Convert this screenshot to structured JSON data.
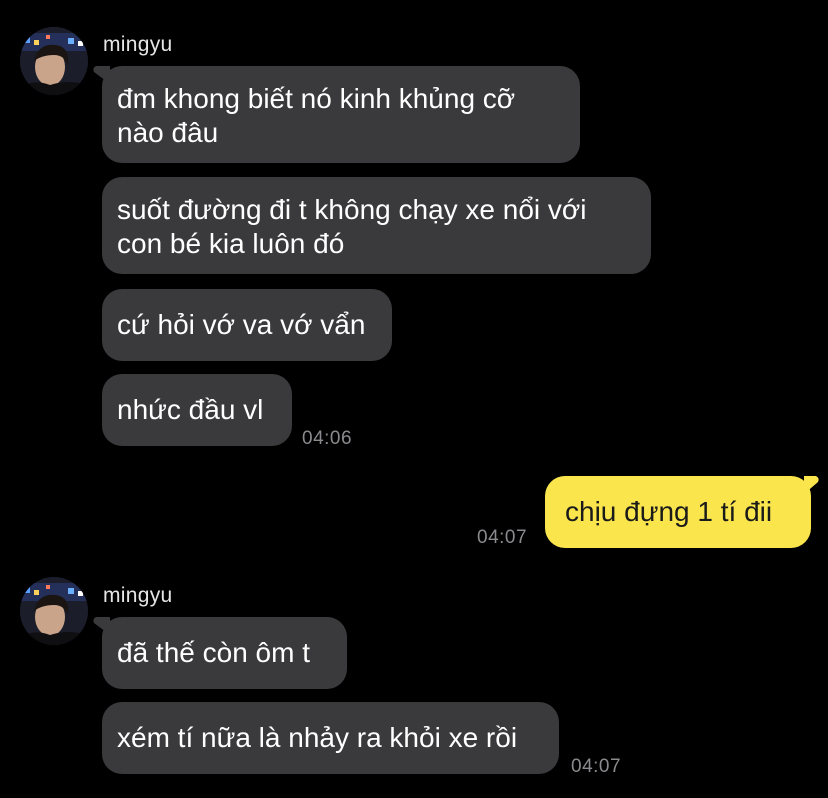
{
  "chat": {
    "groups": [
      {
        "sender": "mingyu",
        "messages": [
          "đm khong biết nó kinh khủng cỡ\nnào đâu",
          "suốt đường đi t không chạy xe nổi với\ncon bé kia luôn đó",
          "cứ hỏi vớ va vớ vẩn",
          "nhức đầu vl"
        ],
        "time": "04:06"
      },
      {
        "sender": "me",
        "messages": [
          "chịu đựng 1 tí đii"
        ],
        "time": "04:07"
      },
      {
        "sender": "mingyu",
        "messages": [
          "đã thế còn ôm t",
          "xém tí nữa là nhảy ra khỏi xe rồi"
        ],
        "time": "04:07"
      }
    ]
  },
  "colors": {
    "background": "#000000",
    "incoming_bubble": "#3a3a3c",
    "outgoing_bubble": "#fae64c",
    "timestamp": "#8a8a8e"
  }
}
